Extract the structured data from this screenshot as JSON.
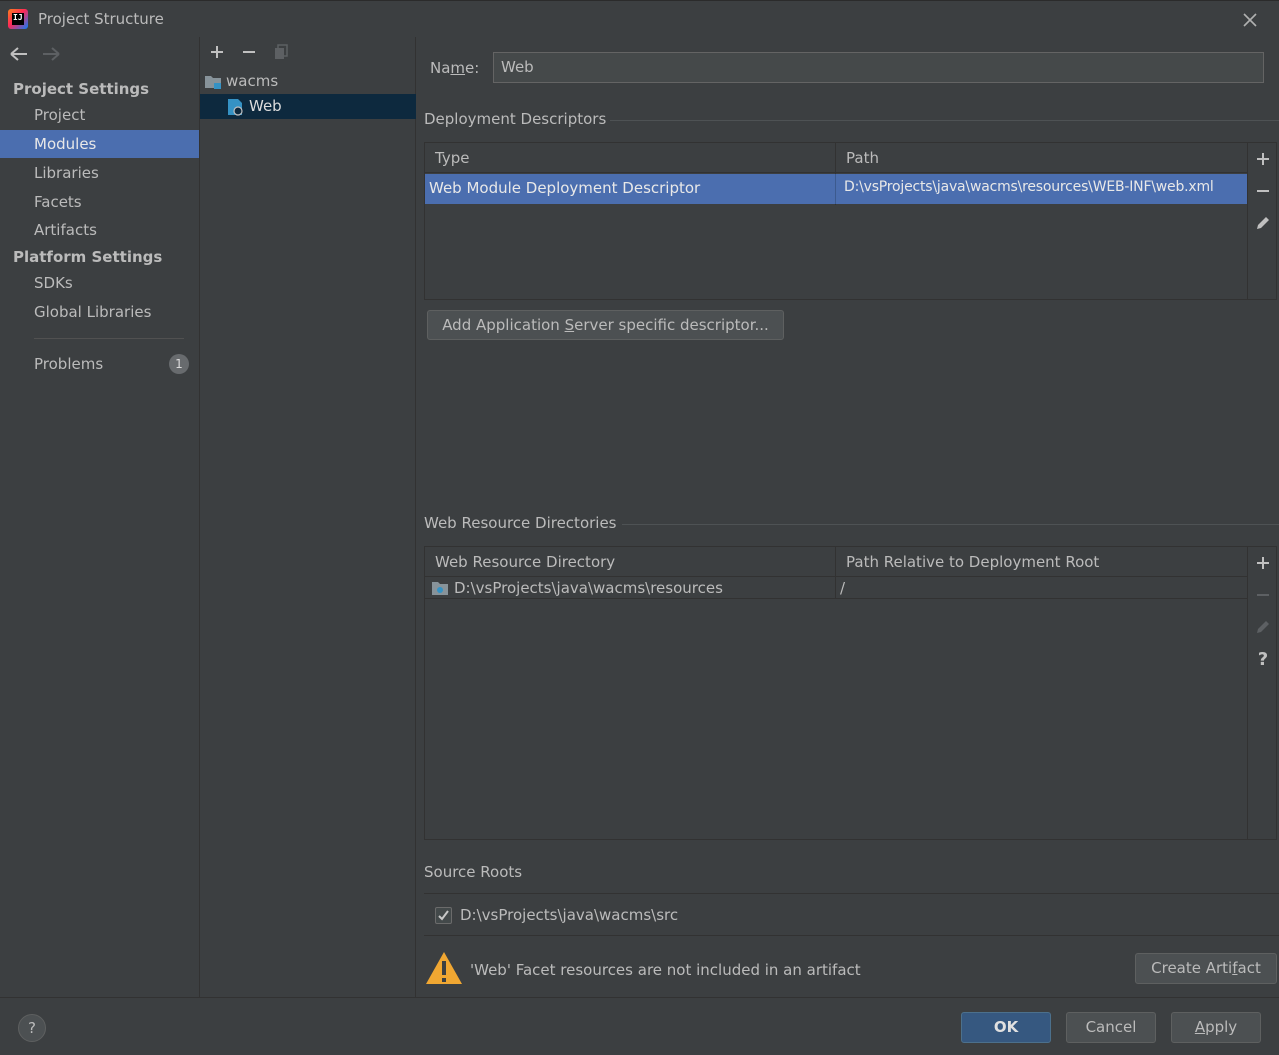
{
  "window": {
    "title": "Project Structure"
  },
  "nav": {
    "back_icon": "arrow-left-icon",
    "forward_icon": "arrow-right-icon",
    "project_settings_header": "Project Settings",
    "project_settings_items": [
      "Project",
      "Modules",
      "Libraries",
      "Facets",
      "Artifacts"
    ],
    "platform_settings_header": "Platform Settings",
    "platform_settings_items": [
      "SDKs",
      "Global Libraries"
    ],
    "problems_label": "Problems",
    "problems_count": "1",
    "selected": "Modules"
  },
  "tree": {
    "toolbar": [
      "add-icon",
      "remove-icon",
      "copy-icon"
    ],
    "root": "wacms",
    "child": "Web"
  },
  "facet": {
    "name_label": "Name:",
    "name_label_mnemonic": "m",
    "name_value": "Web",
    "deployment_descriptors": {
      "title": "Deployment Descriptors",
      "columns": [
        "Type",
        "Path"
      ],
      "rows": [
        {
          "type": "Web Module Deployment Descriptor",
          "path": "D:\\vsProjects\\java\\wacms\\resources\\WEB-INF\\web.xml"
        }
      ],
      "add_server_descriptor_button": "Add Application Server specific descriptor...",
      "add_server_descriptor_pre": "Add Application ",
      "add_server_descriptor_mn": "S",
      "add_server_descriptor_post": "erver specific descriptor..."
    },
    "web_resource_directories": {
      "title": "Web Resource Directories",
      "columns": [
        "Web Resource Directory",
        "Path Relative to Deployment Root"
      ],
      "rows": [
        {
          "directory": "D:\\vsProjects\\java\\wacms\\resources",
          "relative_path": "/"
        }
      ]
    },
    "source_roots": {
      "title": "Source Roots",
      "items": [
        {
          "path": "D:\\vsProjects\\java\\wacms\\src",
          "checked": true
        }
      ]
    },
    "warning": {
      "text": "'Web' Facet resources are not included in an artifact",
      "action_pre": "Create Arti",
      "action_mn": "f",
      "action_post": "act"
    }
  },
  "footer": {
    "help": "?",
    "ok": "OK",
    "cancel": "Cancel",
    "apply_mn": "A",
    "apply_rest": "pply"
  },
  "colors": {
    "background": "#3c3f41",
    "selection": "#4b6eaf",
    "tree_selection": "#0d293e",
    "primary_button": "#365880",
    "warning": "#f0a732"
  }
}
